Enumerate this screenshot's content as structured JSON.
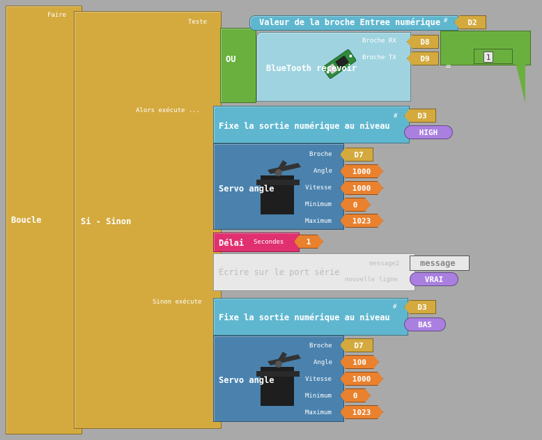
{
  "loop": {
    "faire": "Faire",
    "title": "Boucle"
  },
  "ifelse": {
    "title": "Si - Sinon",
    "teste": "Teste",
    "alors": "Alors exécute ...",
    "sinon": "Sinon exécute"
  },
  "condition": {
    "or_label": "OU",
    "digital_read": {
      "label": "Valeur de la broche Entree numérique",
      "hash": "#",
      "pin": "D2"
    },
    "bluetooth": {
      "label": "BlueTooth recevoir",
      "rx_label": "Broche RX",
      "rx_pin": "D8",
      "tx_label": "Broche TX",
      "tx_pin": "D9"
    },
    "compare": {
      "op": "=",
      "value": "1"
    }
  },
  "then": {
    "digital_write": {
      "label": "Fixe la sortie numérique au niveau",
      "hash": "#",
      "pin": "D3",
      "level": "HIGH"
    },
    "servo": {
      "label": "Servo angle",
      "broche_label": "Broche",
      "broche": "D7",
      "angle_label": "Angle",
      "angle": "1000",
      "vitesse_label": "Vitesse",
      "vitesse": "1000",
      "min_label": "Minimum",
      "min": "0",
      "max_label": "Maximum",
      "max": "1023"
    },
    "delay": {
      "label": "Délai",
      "sec_label": "Secondes",
      "value": "1"
    },
    "serial": {
      "label": "Écrire sur le port série",
      "msg_label": "message2",
      "msg": "message",
      "nl_label": "nouvelle ligne",
      "nl": "VRAI"
    }
  },
  "else": {
    "digital_write": {
      "label": "Fixe la sortie numérique au niveau",
      "hash": "#",
      "pin": "D3",
      "level": "BAS"
    },
    "servo": {
      "label": "Servo angle",
      "broche_label": "Broche",
      "broche": "D7",
      "angle_label": "Angle",
      "angle": "100",
      "vitesse_label": "Vitesse",
      "vitesse": "1000",
      "min_label": "Minimum",
      "min": "0",
      "max_label": "Maximum",
      "max": "1023"
    }
  },
  "colors": {
    "loop": "#d4aa3f",
    "logic": "#6ab03e",
    "io": "#5fb7cf",
    "servo": "#4a82ad",
    "delay": "#e0306f",
    "serial": "#e8e8e8",
    "number": "#e9812e",
    "boolean": "#a97fe0"
  }
}
